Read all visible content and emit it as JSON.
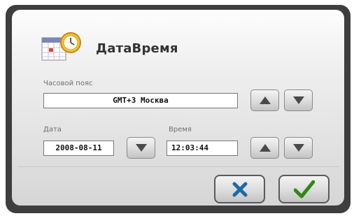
{
  "dialog": {
    "title": "ДатаВремя"
  },
  "timezone": {
    "label": "Часовой пояс",
    "value": "GMT+3 Москва"
  },
  "date": {
    "label": "Дата",
    "value": "2008-08-11"
  },
  "time": {
    "label": "Время",
    "value": "12:03:44"
  },
  "icons": {
    "app": "calendar-clock-icon",
    "up": "arrow-up-icon",
    "down": "arrow-down-icon",
    "cancel": "cross-icon",
    "ok": "checkmark-icon"
  },
  "colors": {
    "cancel": "#1c6aa6",
    "ok": "#2f8a12",
    "frame": "#3e3e3e"
  }
}
